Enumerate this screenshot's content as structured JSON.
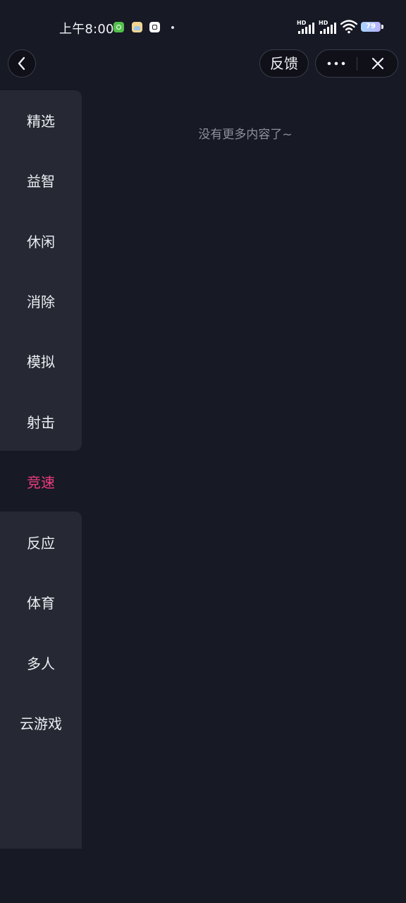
{
  "status_bar": {
    "time": "上午8:00",
    "signal_labels": [
      "HD",
      "HD"
    ],
    "battery": "79",
    "icons": [
      "wechat-icon",
      "app-icon",
      "alarm-icon",
      "more-dot-icon",
      "signal-icon",
      "signal-icon",
      "wifi-icon",
      "battery-icon"
    ]
  },
  "nav": {
    "back_icon": "chevron-left-icon",
    "feedback_label": "反馈",
    "more_icon": "more-dots-icon",
    "close_icon": "close-icon"
  },
  "sidebar": {
    "items": [
      {
        "label": "精选",
        "active": false
      },
      {
        "label": "益智",
        "active": false
      },
      {
        "label": "休闲",
        "active": false
      },
      {
        "label": "消除",
        "active": false
      },
      {
        "label": "模拟",
        "active": false
      },
      {
        "label": "射击",
        "active": false
      },
      {
        "label": "竞速",
        "active": true
      },
      {
        "label": "反应",
        "active": false
      },
      {
        "label": "体育",
        "active": false
      },
      {
        "label": "多人",
        "active": false
      },
      {
        "label": "云游戏",
        "active": false
      }
    ]
  },
  "content": {
    "empty_message": "没有更多内容了~"
  },
  "colors": {
    "background": "#171925",
    "sidebar": "#262933",
    "active": "#ec3d7d"
  }
}
